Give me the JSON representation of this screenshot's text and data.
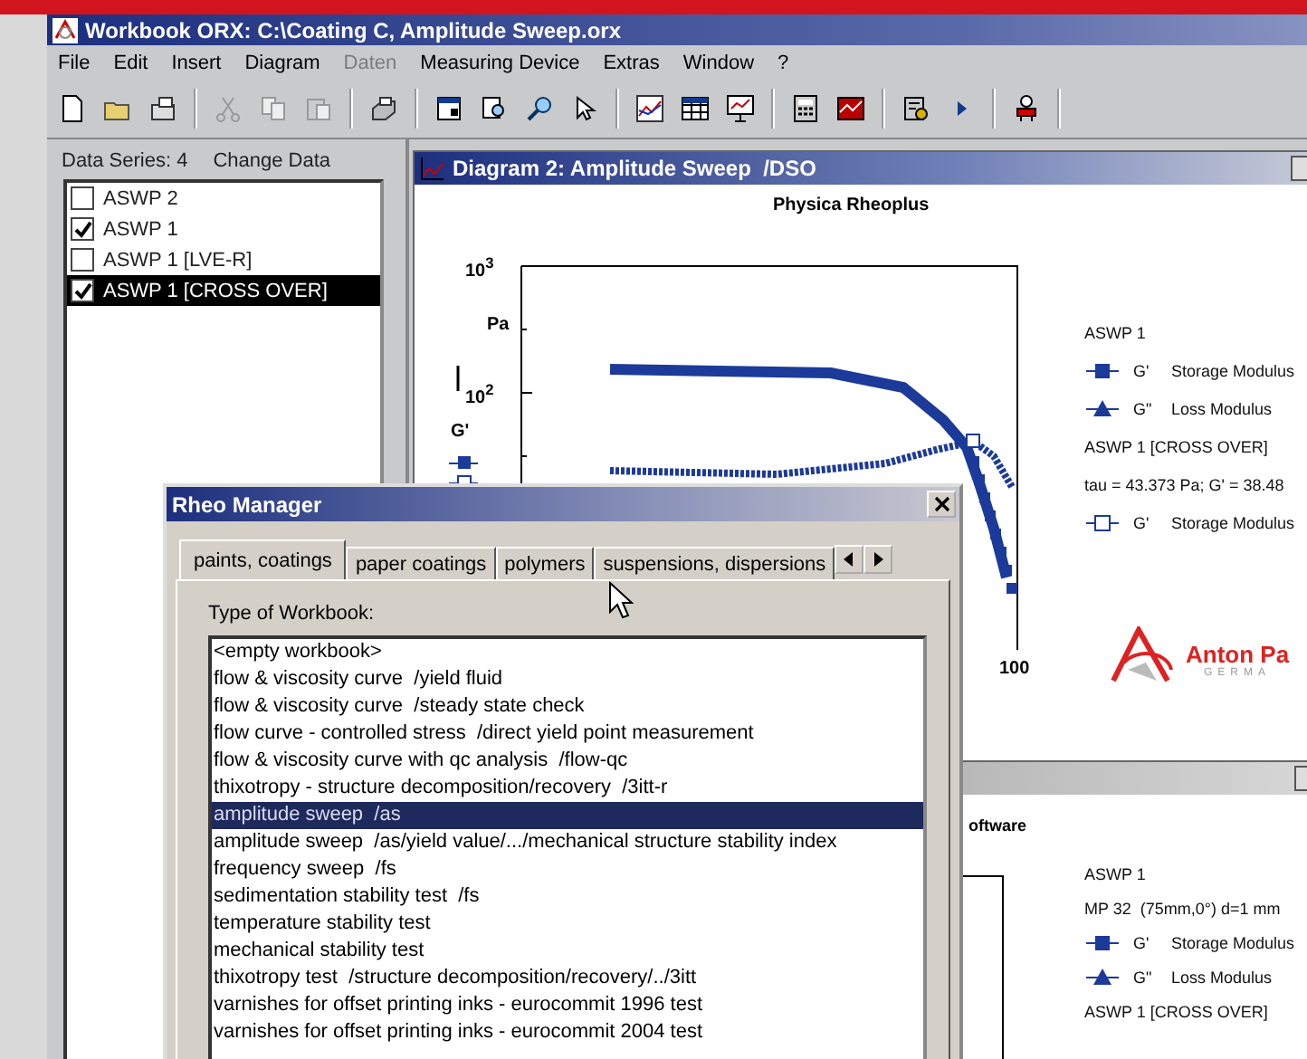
{
  "window": {
    "title": "Workbook ORX: C:\\Coating C, Amplitude Sweep.orx"
  },
  "menu": [
    {
      "label": "File",
      "disabled": false
    },
    {
      "label": "Edit",
      "disabled": false
    },
    {
      "label": "Insert",
      "disabled": false
    },
    {
      "label": "Diagram",
      "disabled": false
    },
    {
      "label": "Daten",
      "disabled": true
    },
    {
      "label": "Measuring Device",
      "disabled": false
    },
    {
      "label": "Extras",
      "disabled": false
    },
    {
      "label": "Window",
      "disabled": false
    },
    {
      "label": "?",
      "disabled": false
    }
  ],
  "data_panel": {
    "count_label": "Data Series: 4",
    "change_label": "Change Data",
    "series": [
      {
        "label": "ASWP 2",
        "checked": false,
        "selected": false
      },
      {
        "label": "ASWP 1",
        "checked": true,
        "selected": false
      },
      {
        "label": "ASWP 1 [LVE-R]",
        "checked": false,
        "selected": false
      },
      {
        "label": "ASWP 1 [CROSS OVER]",
        "checked": true,
        "selected": true
      }
    ]
  },
  "diagram": {
    "title": "Diagram 2: Amplitude Sweep  /DSO",
    "chart_title": "Physica Rheoplus",
    "y_tick_top": "10$^{3}$",
    "y_unit": "Pa",
    "y_tick_mid": "10$^{2}$",
    "y_symbol": "G'",
    "x_tick": "100",
    "legend": [
      {
        "kind": "header",
        "text": "ASWP 1"
      },
      {
        "kind": "square",
        "symbol": "G'",
        "text": "Storage Modulus"
      },
      {
        "kind": "triangle",
        "symbol": "G\"",
        "text": "Loss Modulus"
      },
      {
        "kind": "header",
        "text": "ASWP 1 [CROSS OVER]"
      },
      {
        "kind": "header",
        "text": "tau = 43.373 Pa; G' = 38.48"
      },
      {
        "kind": "hollow",
        "symbol": "G'",
        "text": "Storage Modulus"
      }
    ],
    "logo": {
      "name": "Anton Pa",
      "sub": "GERMA"
    }
  },
  "diagram2": {
    "fragment": "oftware",
    "legend": [
      {
        "kind": "header",
        "text": "ASWP 1"
      },
      {
        "kind": "header",
        "text": "MP 32  (75mm,0°) d=1 mm"
      },
      {
        "kind": "square",
        "symbol": "G'",
        "text": "Storage Modulus"
      },
      {
        "kind": "triangle",
        "symbol": "G\"",
        "text": "Loss Modulus"
      },
      {
        "kind": "header",
        "text": "ASWP 1 [CROSS OVER]"
      }
    ]
  },
  "dialog": {
    "title": "Rheo Manager",
    "tabs": [
      {
        "label": "paints, coatings",
        "selected": true
      },
      {
        "label": "paper coatings",
        "selected": false
      },
      {
        "label": "polymers",
        "selected": false
      },
      {
        "label": "suspensions, dispersions",
        "selected": false
      }
    ],
    "list_label": "Type of Workbook:",
    "items": [
      {
        "label": "<empty workbook>",
        "selected": false
      },
      {
        "label": "flow & viscosity curve  /yield fluid",
        "selected": false
      },
      {
        "label": "flow & viscosity curve  /steady state check",
        "selected": false
      },
      {
        "label": "flow curve - controlled stress  /direct yield point measurement",
        "selected": false
      },
      {
        "label": "flow & viscosity curve with qc analysis  /flow-qc",
        "selected": false
      },
      {
        "label": "thixotropy - structure decomposition/recovery  /3itt-r",
        "selected": false
      },
      {
        "label": "amplitude sweep  /as",
        "selected": true
      },
      {
        "label": "amplitude sweep  /as/yield value/.../mechanical structure stability index",
        "selected": false
      },
      {
        "label": "frequency sweep  /fs",
        "selected": false
      },
      {
        "label": "sedimentation stability test  /fs",
        "selected": false
      },
      {
        "label": "temperature stability test",
        "selected": false
      },
      {
        "label": "mechanical stability test",
        "selected": false
      },
      {
        "label": "thixotropy test  /structure decomposition/recovery/../3itt",
        "selected": false
      },
      {
        "label": "varnishes for offset printing inks - eurocommit 1996 test",
        "selected": false
      },
      {
        "label": "varnishes for offset printing inks - eurocommit 2004 test",
        "selected": false
      }
    ]
  }
}
